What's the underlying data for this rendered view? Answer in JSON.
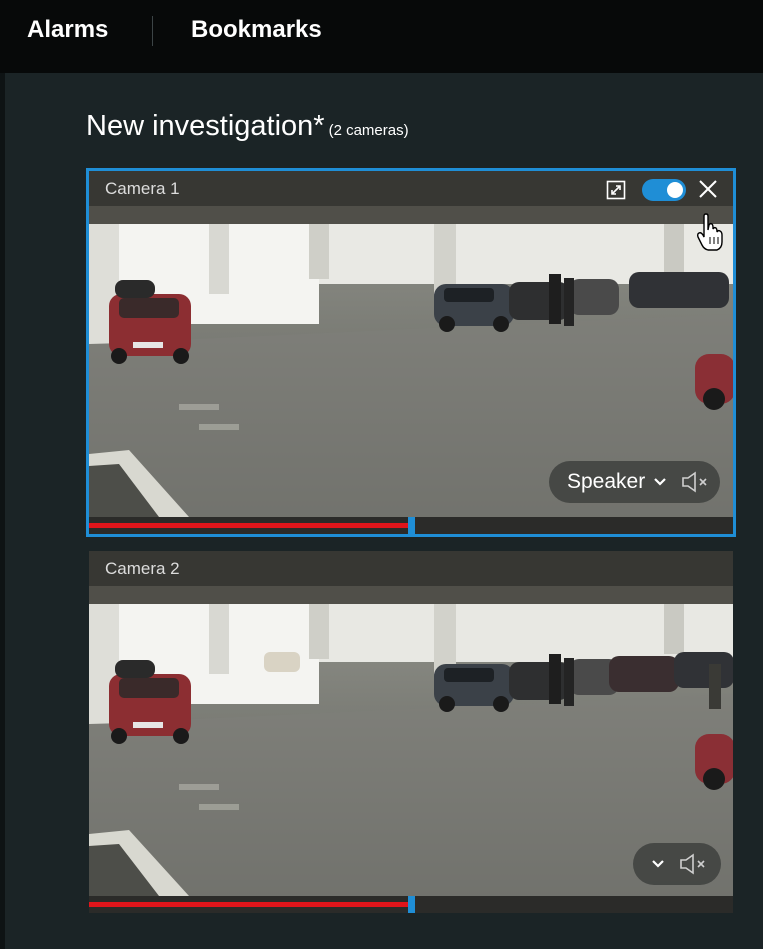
{
  "tabs": {
    "alarms": "Alarms",
    "bookmarks": "Bookmarks"
  },
  "investigation": {
    "title": "New investigation*",
    "camera_count": "(2 cameras)"
  },
  "cameras": [
    {
      "label": "Camera 1",
      "selected": true,
      "audio_output": "Speaker",
      "live_toggle": "on",
      "timeline_progress": 0.5
    },
    {
      "label": "Camera 2",
      "selected": false,
      "timeline_progress": 0.5
    }
  ],
  "colors": {
    "accent": "#1f8ed6",
    "timeline_recording": "#e0151b",
    "background": "#1b2426",
    "topbar": "#070909"
  },
  "icons": {
    "expand": "expand-icon",
    "toggle": "toggle-switch",
    "close": "close-icon",
    "chevron": "chevron-down-icon",
    "muted_speaker": "speaker-muted-icon",
    "cursor": "hand-cursor-icon"
  }
}
